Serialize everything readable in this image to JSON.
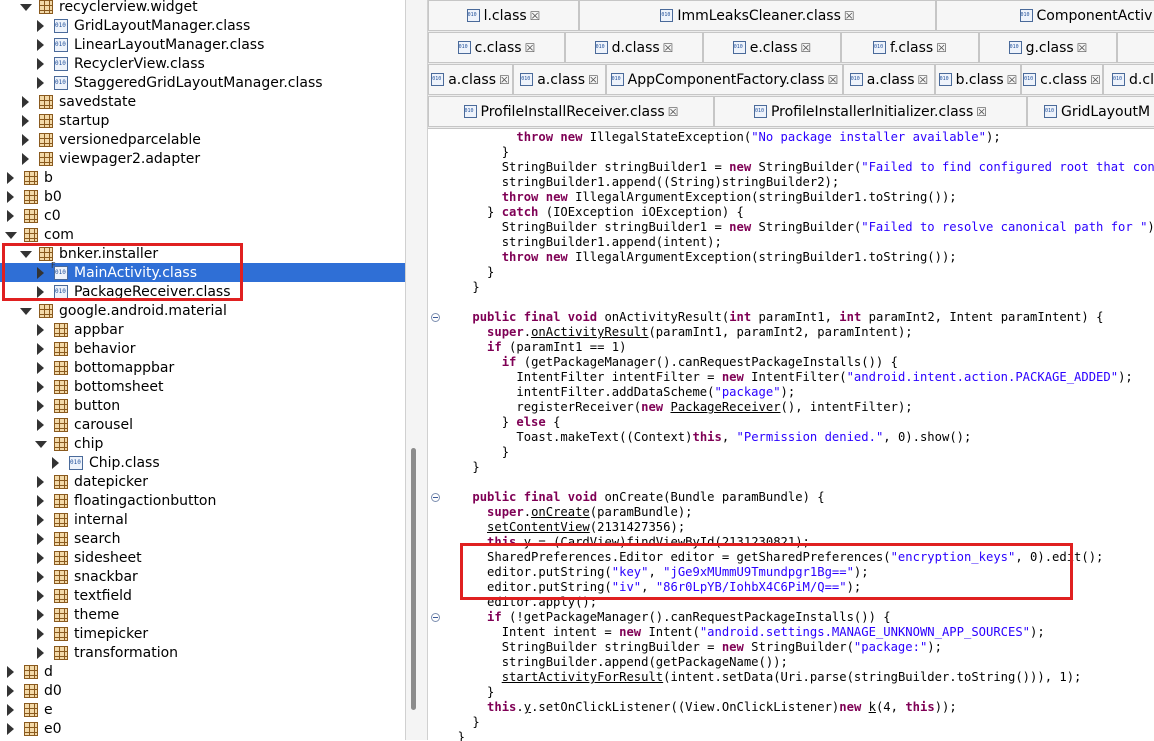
{
  "tree": {
    "rows": [
      {
        "label": "recyclerview.widget",
        "type": "package",
        "depth": 1,
        "state": "open"
      },
      {
        "label": "GridLayoutManager.class",
        "type": "class",
        "depth": 2,
        "state": "closed"
      },
      {
        "label": "LinearLayoutManager.class",
        "type": "class",
        "depth": 2,
        "state": "closed"
      },
      {
        "label": "RecyclerView.class",
        "type": "class",
        "depth": 2,
        "state": "closed"
      },
      {
        "label": "StaggeredGridLayoutManager.class",
        "type": "class",
        "depth": 2,
        "state": "closed"
      },
      {
        "label": "savedstate",
        "type": "package",
        "depth": 1,
        "state": "closed"
      },
      {
        "label": "startup",
        "type": "package",
        "depth": 1,
        "state": "closed"
      },
      {
        "label": "versionedparcelable",
        "type": "package",
        "depth": 1,
        "state": "closed"
      },
      {
        "label": "viewpager2.adapter",
        "type": "package",
        "depth": 1,
        "state": "closed"
      },
      {
        "label": "b",
        "type": "package",
        "depth": 0,
        "state": "closed"
      },
      {
        "label": "b0",
        "type": "package",
        "depth": 0,
        "state": "closed"
      },
      {
        "label": "c0",
        "type": "package",
        "depth": 0,
        "state": "closed"
      },
      {
        "label": "com",
        "type": "package",
        "depth": 0,
        "state": "open"
      },
      {
        "label": "bnker.installer",
        "type": "package",
        "depth": 1,
        "state": "open"
      },
      {
        "label": "MainActivity.class",
        "type": "class",
        "depth": 2,
        "state": "closed",
        "selected": true
      },
      {
        "label": "PackageReceiver.class",
        "type": "class",
        "depth": 2,
        "state": "closed"
      },
      {
        "label": "google.android.material",
        "type": "package",
        "depth": 1,
        "state": "open"
      },
      {
        "label": "appbar",
        "type": "package",
        "depth": 2,
        "state": "closed"
      },
      {
        "label": "behavior",
        "type": "package",
        "depth": 2,
        "state": "closed"
      },
      {
        "label": "bottomappbar",
        "type": "package",
        "depth": 2,
        "state": "closed"
      },
      {
        "label": "bottomsheet",
        "type": "package",
        "depth": 2,
        "state": "closed"
      },
      {
        "label": "button",
        "type": "package",
        "depth": 2,
        "state": "closed"
      },
      {
        "label": "carousel",
        "type": "package",
        "depth": 2,
        "state": "closed"
      },
      {
        "label": "chip",
        "type": "package",
        "depth": 2,
        "state": "open"
      },
      {
        "label": "Chip.class",
        "type": "class",
        "depth": 3,
        "state": "closed"
      },
      {
        "label": "datepicker",
        "type": "package",
        "depth": 2,
        "state": "closed"
      },
      {
        "label": "floatingactionbutton",
        "type": "package",
        "depth": 2,
        "state": "closed"
      },
      {
        "label": "internal",
        "type": "package",
        "depth": 2,
        "state": "closed"
      },
      {
        "label": "search",
        "type": "package",
        "depth": 2,
        "state": "closed"
      },
      {
        "label": "sidesheet",
        "type": "package",
        "depth": 2,
        "state": "closed"
      },
      {
        "label": "snackbar",
        "type": "package",
        "depth": 2,
        "state": "closed"
      },
      {
        "label": "textfield",
        "type": "package",
        "depth": 2,
        "state": "closed"
      },
      {
        "label": "theme",
        "type": "package",
        "depth": 2,
        "state": "closed"
      },
      {
        "label": "timepicker",
        "type": "package",
        "depth": 2,
        "state": "closed"
      },
      {
        "label": "transformation",
        "type": "package",
        "depth": 2,
        "state": "closed"
      },
      {
        "label": "d",
        "type": "package",
        "depth": 0,
        "state": "closed"
      },
      {
        "label": "d0",
        "type": "package",
        "depth": 0,
        "state": "closed"
      },
      {
        "label": "e",
        "type": "package",
        "depth": 0,
        "state": "closed"
      },
      {
        "label": "e0",
        "type": "package",
        "depth": 0,
        "state": "closed"
      }
    ]
  },
  "tabs": {
    "close_glyph": "☒",
    "rows": [
      [
        "l.class",
        "ImmLeaksCleaner.class",
        "ComponentActiv"
      ],
      [
        "c.class",
        "d.class",
        "e.class",
        "f.class",
        "g.class",
        ""
      ],
      [
        "a.class",
        "a.class",
        "AppComponentFactory.class",
        "a.class",
        "b.class",
        "c.class",
        "d.cl"
      ],
      [
        "ProfileInstallReceiver.class",
        "ProfileInstallerInitializer.class",
        "GridLayoutM"
      ]
    ]
  },
  "code": {
    "lines": [
      [
        {
          "t": "          "
        },
        {
          "t": "throw",
          "k": "kw"
        },
        {
          "t": " "
        },
        {
          "t": "new",
          "k": "kw"
        },
        {
          "t": " IllegalStateException("
        },
        {
          "t": "\"No package installer available\"",
          "k": "st"
        },
        {
          "t": ");"
        }
      ],
      [
        {
          "t": "        }"
        }
      ],
      [
        {
          "t": "        StringBuilder stringBuilder1 = "
        },
        {
          "t": "new",
          "k": "kw"
        },
        {
          "t": " StringBuilder("
        },
        {
          "t": "\"Failed to find configured root that contains \"",
          "k": "st"
        },
        {
          "t": ");"
        }
      ],
      [
        {
          "t": "        stringBuilder1.append((String)stringBuilder2);"
        }
      ],
      [
        {
          "t": "        "
        },
        {
          "t": "throw",
          "k": "kw"
        },
        {
          "t": " "
        },
        {
          "t": "new",
          "k": "kw"
        },
        {
          "t": " IllegalArgumentException(stringBuilder1.toString());"
        }
      ],
      [
        {
          "t": "      } "
        },
        {
          "t": "catch",
          "k": "kw"
        },
        {
          "t": " (IOException iOException) {"
        }
      ],
      [
        {
          "t": "        StringBuilder stringBuilder1 = "
        },
        {
          "t": "new",
          "k": "kw"
        },
        {
          "t": " StringBuilder("
        },
        {
          "t": "\"Failed to resolve canonical path for \"",
          "k": "st"
        },
        {
          "t": ");"
        }
      ],
      [
        {
          "t": "        stringBuilder1.append(intent);"
        }
      ],
      [
        {
          "t": "        "
        },
        {
          "t": "throw",
          "k": "kw"
        },
        {
          "t": " "
        },
        {
          "t": "new",
          "k": "kw"
        },
        {
          "t": " IllegalArgumentException(stringBuilder1.toString());"
        }
      ],
      [
        {
          "t": "      }"
        }
      ],
      [
        {
          "t": "    }"
        }
      ],
      [],
      [
        {
          "t": "    "
        },
        {
          "t": "public",
          "k": "kw"
        },
        {
          "t": " "
        },
        {
          "t": "final",
          "k": "kw"
        },
        {
          "t": " "
        },
        {
          "t": "void",
          "k": "kw"
        },
        {
          "t": " onActivityResult("
        },
        {
          "t": "int",
          "k": "kw"
        },
        {
          "t": " paramInt1, "
        },
        {
          "t": "int",
          "k": "kw"
        },
        {
          "t": " paramInt2, Intent paramIntent) {"
        }
      ],
      [
        {
          "t": "      "
        },
        {
          "t": "super",
          "k": "kw"
        },
        {
          "t": "."
        },
        {
          "t": "onActivityResult",
          "k": "ul"
        },
        {
          "t": "(paramInt1, paramInt2, paramIntent);"
        }
      ],
      [
        {
          "t": "      "
        },
        {
          "t": "if",
          "k": "kw"
        },
        {
          "t": " (paramInt1 == 1)"
        }
      ],
      [
        {
          "t": "        "
        },
        {
          "t": "if",
          "k": "kw"
        },
        {
          "t": " (getPackageManager().canRequestPackageInstalls()) {"
        }
      ],
      [
        {
          "t": "          IntentFilter intentFilter = "
        },
        {
          "t": "new",
          "k": "kw"
        },
        {
          "t": " IntentFilter("
        },
        {
          "t": "\"android.intent.action.PACKAGE_ADDED\"",
          "k": "st"
        },
        {
          "t": ");"
        }
      ],
      [
        {
          "t": "          intentFilter.addDataScheme("
        },
        {
          "t": "\"package\"",
          "k": "st"
        },
        {
          "t": ");"
        }
      ],
      [
        {
          "t": "          registerReceiver("
        },
        {
          "t": "new",
          "k": "kw"
        },
        {
          "t": " "
        },
        {
          "t": "PackageReceiver",
          "k": "ul"
        },
        {
          "t": "(), intentFilter);"
        }
      ],
      [
        {
          "t": "        } "
        },
        {
          "t": "else",
          "k": "kw"
        },
        {
          "t": " {"
        }
      ],
      [
        {
          "t": "          Toast.makeText((Context)"
        },
        {
          "t": "this",
          "k": "kw"
        },
        {
          "t": ", "
        },
        {
          "t": "\"Permission denied.\"",
          "k": "st"
        },
        {
          "t": ", 0).show();"
        }
      ],
      [
        {
          "t": "        }"
        }
      ],
      [
        {
          "t": "    }"
        }
      ],
      [],
      [
        {
          "t": "    "
        },
        {
          "t": "public",
          "k": "kw"
        },
        {
          "t": " "
        },
        {
          "t": "final",
          "k": "kw"
        },
        {
          "t": " "
        },
        {
          "t": "void",
          "k": "kw"
        },
        {
          "t": " onCreate(Bundle paramBundle) {"
        }
      ],
      [
        {
          "t": "      "
        },
        {
          "t": "super",
          "k": "kw"
        },
        {
          "t": "."
        },
        {
          "t": "onCreate",
          "k": "ul"
        },
        {
          "t": "(paramBundle);"
        }
      ],
      [
        {
          "t": "      "
        },
        {
          "t": "setContentView",
          "k": "ul"
        },
        {
          "t": "(2131427356);"
        }
      ],
      [
        {
          "t": "      "
        },
        {
          "t": "this",
          "k": "kw"
        },
        {
          "t": ".y = (CardView)findViewById(2131230821);"
        }
      ],
      [
        {
          "t": "      SharedPreferences.Editor editor = getSharedPreferences("
        },
        {
          "t": "\"encryption_keys\"",
          "k": "st"
        },
        {
          "t": ", 0).edit();"
        }
      ],
      [
        {
          "t": "      editor.putString("
        },
        {
          "t": "\"key\"",
          "k": "st"
        },
        {
          "t": ", "
        },
        {
          "t": "\"jGe9xMUmmU9Tmundpgr1Bg==\"",
          "k": "st"
        },
        {
          "t": ");"
        }
      ],
      [
        {
          "t": "      editor.putString("
        },
        {
          "t": "\"iv\"",
          "k": "st"
        },
        {
          "t": ", "
        },
        {
          "t": "\"86r0LpYB/IohbX4C6PiM/Q==\"",
          "k": "st"
        },
        {
          "t": ");"
        }
      ],
      [
        {
          "t": "      editor.apply();"
        }
      ],
      [
        {
          "t": "      "
        },
        {
          "t": "if",
          "k": "kw"
        },
        {
          "t": " (!getPackageManager().canRequestPackageInstalls()) {"
        }
      ],
      [
        {
          "t": "        Intent intent = "
        },
        {
          "t": "new",
          "k": "kw"
        },
        {
          "t": " Intent("
        },
        {
          "t": "\"android.settings.MANAGE_UNKNOWN_APP_SOURCES\"",
          "k": "st"
        },
        {
          "t": ");"
        }
      ],
      [
        {
          "t": "        StringBuilder stringBuilder = "
        },
        {
          "t": "new",
          "k": "kw"
        },
        {
          "t": " StringBuilder("
        },
        {
          "t": "\"package:\"",
          "k": "st"
        },
        {
          "t": ");"
        }
      ],
      [
        {
          "t": "        stringBuilder.append(getPackageName());"
        }
      ],
      [
        {
          "t": "        "
        },
        {
          "t": "startActivityForResult",
          "k": "ul"
        },
        {
          "t": "(intent.setData(Uri.parse(stringBuilder.toString())), 1);"
        }
      ],
      [
        {
          "t": "      }"
        }
      ],
      [
        {
          "t": "      "
        },
        {
          "t": "this",
          "k": "kw"
        },
        {
          "t": "."
        },
        {
          "t": "y",
          "k": "ul"
        },
        {
          "t": ".setOnClickListener((View.OnClickListener)"
        },
        {
          "t": "new",
          "k": "kw"
        },
        {
          "t": " "
        },
        {
          "t": "k",
          "k": "ul"
        },
        {
          "t": "(4, "
        },
        {
          "t": "this",
          "k": "kw"
        },
        {
          "t": "));"
        }
      ],
      [
        {
          "t": "    }"
        }
      ],
      [
        {
          "t": "  }"
        }
      ]
    ]
  },
  "colors": {
    "selection": "#2f6fd6",
    "highlight": "#e02020",
    "keyword": "#7f0055",
    "string": "#2a00ff"
  }
}
